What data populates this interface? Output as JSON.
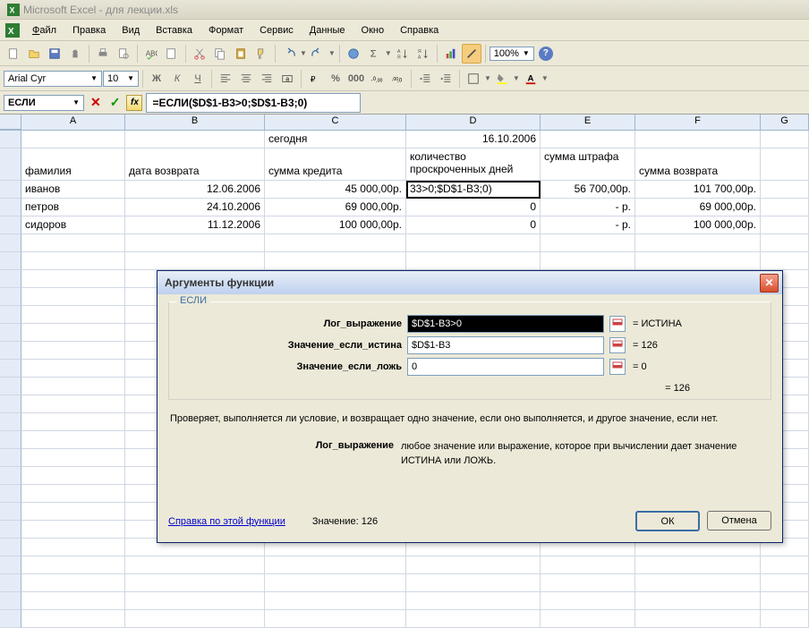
{
  "app": {
    "title": "Microsoft Excel - для лекции.xls"
  },
  "menu": {
    "file": "Файл",
    "edit": "Правка",
    "view": "Вид",
    "insert": "Вставка",
    "format": "Формат",
    "tools": "Сервис",
    "data": "Данные",
    "window": "Окно",
    "help": "Справка"
  },
  "toolbar": {
    "zoom": "100%"
  },
  "formatbar": {
    "font": "Arial Cyr",
    "size": "10"
  },
  "formulabar": {
    "name": "ЕСЛИ",
    "fx": "fx",
    "formula": "=ЕСЛИ($D$1-B3>0;$D$1-B3;0)"
  },
  "columns": [
    "A",
    "B",
    "C",
    "D",
    "E",
    "F",
    "G"
  ],
  "grid": {
    "r1": {
      "C": "сегодня",
      "D": "16.10.2006"
    },
    "r2": {
      "A": "фамилия",
      "B": "дата возврата",
      "C": "сумма кредита",
      "D": "количество проскроченных дней",
      "E": "сумма штрафа",
      "F": "сумма возврата"
    },
    "r3": {
      "A": "иванов",
      "B": "12.06.2006",
      "C": "45 000,00р.",
      "D": "33>0;$D$1-B3;0)",
      "E": "56 700,00р.",
      "F": "101 700,00р."
    },
    "r4": {
      "A": "петров",
      "B": "24.10.2006",
      "C": "69 000,00р.",
      "D": "0",
      "E": "-   р.",
      "F": "69 000,00р."
    },
    "r5": {
      "A": "сидоров",
      "B": "11.12.2006",
      "C": "100 000,00р.",
      "D": "0",
      "E": "-   р.",
      "F": "100 000,00р."
    }
  },
  "dialog": {
    "title": "Аргументы функции",
    "fn": "ЕСЛИ",
    "arg1": {
      "label": "Лог_выражение",
      "value": "$D$1-B3>0",
      "result": "= ИСТИНА"
    },
    "arg2": {
      "label": "Значение_если_истина",
      "value": "$D$1-B3",
      "result": "= 126"
    },
    "arg3": {
      "label": "Значение_если_ложь",
      "value": "0",
      "result": "= 0"
    },
    "preview": "= 126",
    "desc": "Проверяет, выполняется ли условие, и возвращает одно значение, если оно выполняется, и другое значение, если нет.",
    "arg_desc_label": "Лог_выражение",
    "arg_desc": "любое значение или выражение, которое при вычислении дает значение ИСТИНА или ЛОЖЬ.",
    "help": "Справка по этой функции",
    "result_label": "Значение:",
    "result_value": "126",
    "ok": "ОК",
    "cancel": "Отмена"
  }
}
